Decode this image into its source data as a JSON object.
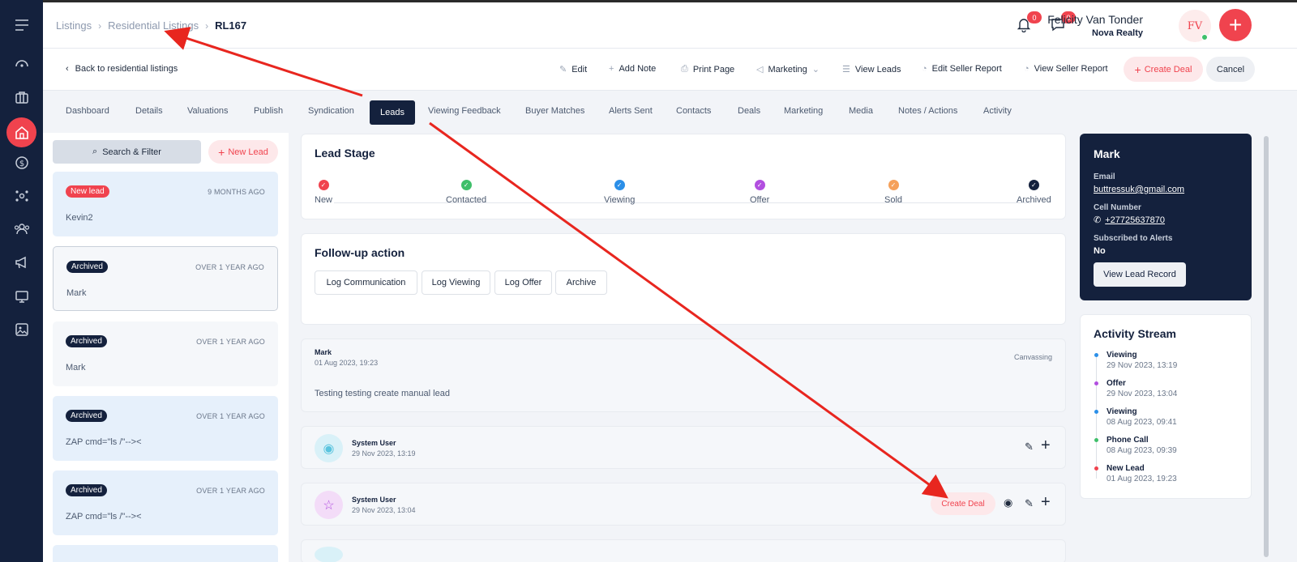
{
  "breadcrumb": {
    "items": [
      "Listings",
      "Residential Listings"
    ],
    "current": "RL167"
  },
  "header": {
    "notifications_count": "0",
    "messages_count": "0",
    "user_name": "Felicity Van Tonder",
    "user_org": "Nova Realty",
    "avatar_initials": "FV"
  },
  "toolbar": {
    "back_label": "Back to residential listings",
    "edit": "Edit",
    "add_note": "Add Note",
    "print_page": "Print Page",
    "marketing": "Marketing",
    "view_leads": "View Leads",
    "edit_seller_report": "Edit Seller Report",
    "view_seller_report": "View Seller Report",
    "create_deal": "Create Deal",
    "cancel": "Cancel"
  },
  "tabs": [
    "Dashboard",
    "Details",
    "Valuations",
    "Publish",
    "Syndication",
    "Leads",
    "Viewing Feedback",
    "Buyer Matches",
    "Alerts Sent",
    "Contacts",
    "Deals",
    "Marketing",
    "Media",
    "Notes / Actions",
    "Activity"
  ],
  "active_tab": "Leads",
  "lead_list": {
    "search_label": "Search & Filter",
    "new_lead_label": "New Lead",
    "items": [
      {
        "tag": "New lead",
        "time": "9 MONTHS AGO",
        "name": "Kevin2"
      },
      {
        "tag": "Archived",
        "time": "OVER 1 YEAR AGO",
        "name": "Mark"
      },
      {
        "tag": "Archived",
        "time": "OVER 1 YEAR AGO",
        "name": "Mark"
      },
      {
        "tag": "Archived",
        "time": "OVER 1 YEAR AGO",
        "name": "ZAP cmd=\"ls /\"--><"
      },
      {
        "tag": "Archived",
        "time": "OVER 1 YEAR AGO",
        "name": "ZAP cmd=\"ls /\"--><"
      }
    ]
  },
  "lead_stage": {
    "title": "Lead Stage",
    "stages": [
      "New",
      "Contacted",
      "Viewing",
      "Offer",
      "Sold",
      "Archived"
    ]
  },
  "follow_up": {
    "title": "Follow-up action",
    "actions": [
      "Log Communication",
      "Log Viewing",
      "Log Offer",
      "Archive"
    ]
  },
  "note": {
    "author": "Mark",
    "time": "01 Aug 2023, 19:23",
    "source": "Canvassing",
    "body": "Testing testing create manual lead"
  },
  "activities": [
    {
      "user": "System User",
      "time": "29 Nov 2023, 13:19"
    },
    {
      "user": "System User",
      "time": "29 Nov 2023, 13:04",
      "action": "Create Deal"
    }
  ],
  "lead_info": {
    "name": "Mark",
    "email_label": "Email",
    "email": "buttressuk@gmail.com",
    "cell_label": "Cell Number",
    "cell": "+27725637870",
    "alerts_label": "Subscribed to Alerts",
    "alerts": "No",
    "view_record": "View Lead Record"
  },
  "activity_stream": {
    "title": "Activity Stream",
    "items": [
      {
        "label": "Viewing",
        "time": "29 Nov 2023, 13:19"
      },
      {
        "label": "Offer",
        "time": "29 Nov 2023, 13:04"
      },
      {
        "label": "Viewing",
        "time": "08 Aug 2023, 09:41"
      },
      {
        "label": "Phone Call",
        "time": "08 Aug 2023, 09:39"
      },
      {
        "label": "New Lead",
        "time": "01 Aug 2023, 19:23"
      }
    ]
  },
  "colors": {
    "accent": "#f0434e",
    "navy": "#14213d",
    "stage_new": "#f0434e",
    "stage_contacted": "#3fbf6a",
    "stage_viewing": "#2b8fe8",
    "stage_offer": "#b24fe0",
    "stage_sold": "#f5a05a",
    "stage_archived": "#14213d"
  }
}
